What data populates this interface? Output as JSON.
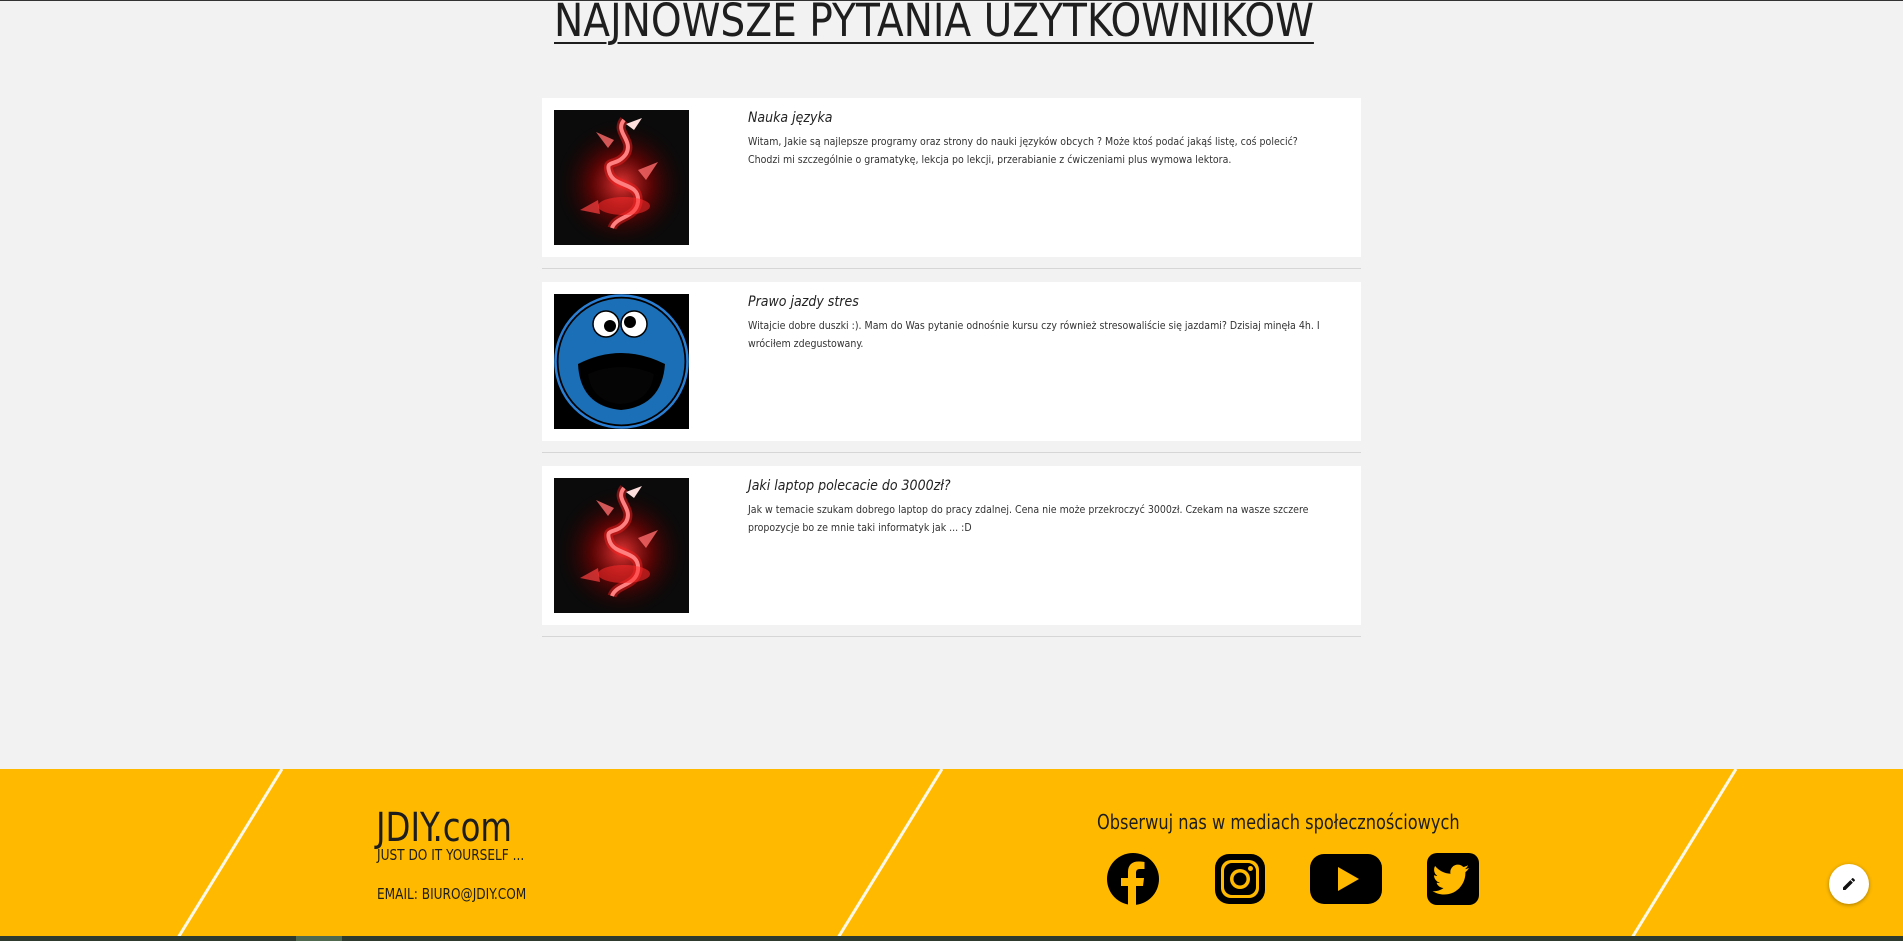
{
  "page": {
    "title": "NAJNOWSZE PYTANIA UŻYTKOWNIKÓW"
  },
  "questions": [
    {
      "avatar_icon": "red-dragon-avatar",
      "title": "Nauka języka",
      "body": "Witam, Jakie są najlepsze programy oraz strony do nauki języków obcych ? Może ktoś podać jakąś listę, coś polecić? Chodzi mi szczególnie o gramatykę, lekcja po lekcji, przerabianie z ćwiczeniami plus wymowa lektora."
    },
    {
      "avatar_icon": "cookie-monster-avatar",
      "title": "Prawo jazdy stres",
      "body": "Witajcie dobre duszki :). Mam do Was pytanie odnośnie kursu czy również stresowaliście się jazdami? Dzisiaj minęła 4h. I wróciłem zdegustowany."
    },
    {
      "avatar_icon": "red-dragon-avatar",
      "title": "Jaki laptop polecacie do 3000zł?",
      "body": "Jak w temacie szukam dobrego laptop do pracy zdalnej. Cena nie może przekroczyć 3000zł. Czekam na wasze szczere propozycje bo ze mnie taki informatyk jak ... :D"
    }
  ],
  "footer": {
    "brand": "JDIY.com",
    "tagline": "JUST DO IT YOURSELF ...",
    "email": "EMAIL: BIURO@JDIY.COM",
    "social_heading": "Obserwuj nas w mediach społecznościowych",
    "social_icons": [
      "facebook-icon",
      "instagram-icon",
      "youtube-icon",
      "twitter-icon"
    ],
    "background_color": "#ffba00"
  },
  "edit_button_icon": "pencil-icon"
}
